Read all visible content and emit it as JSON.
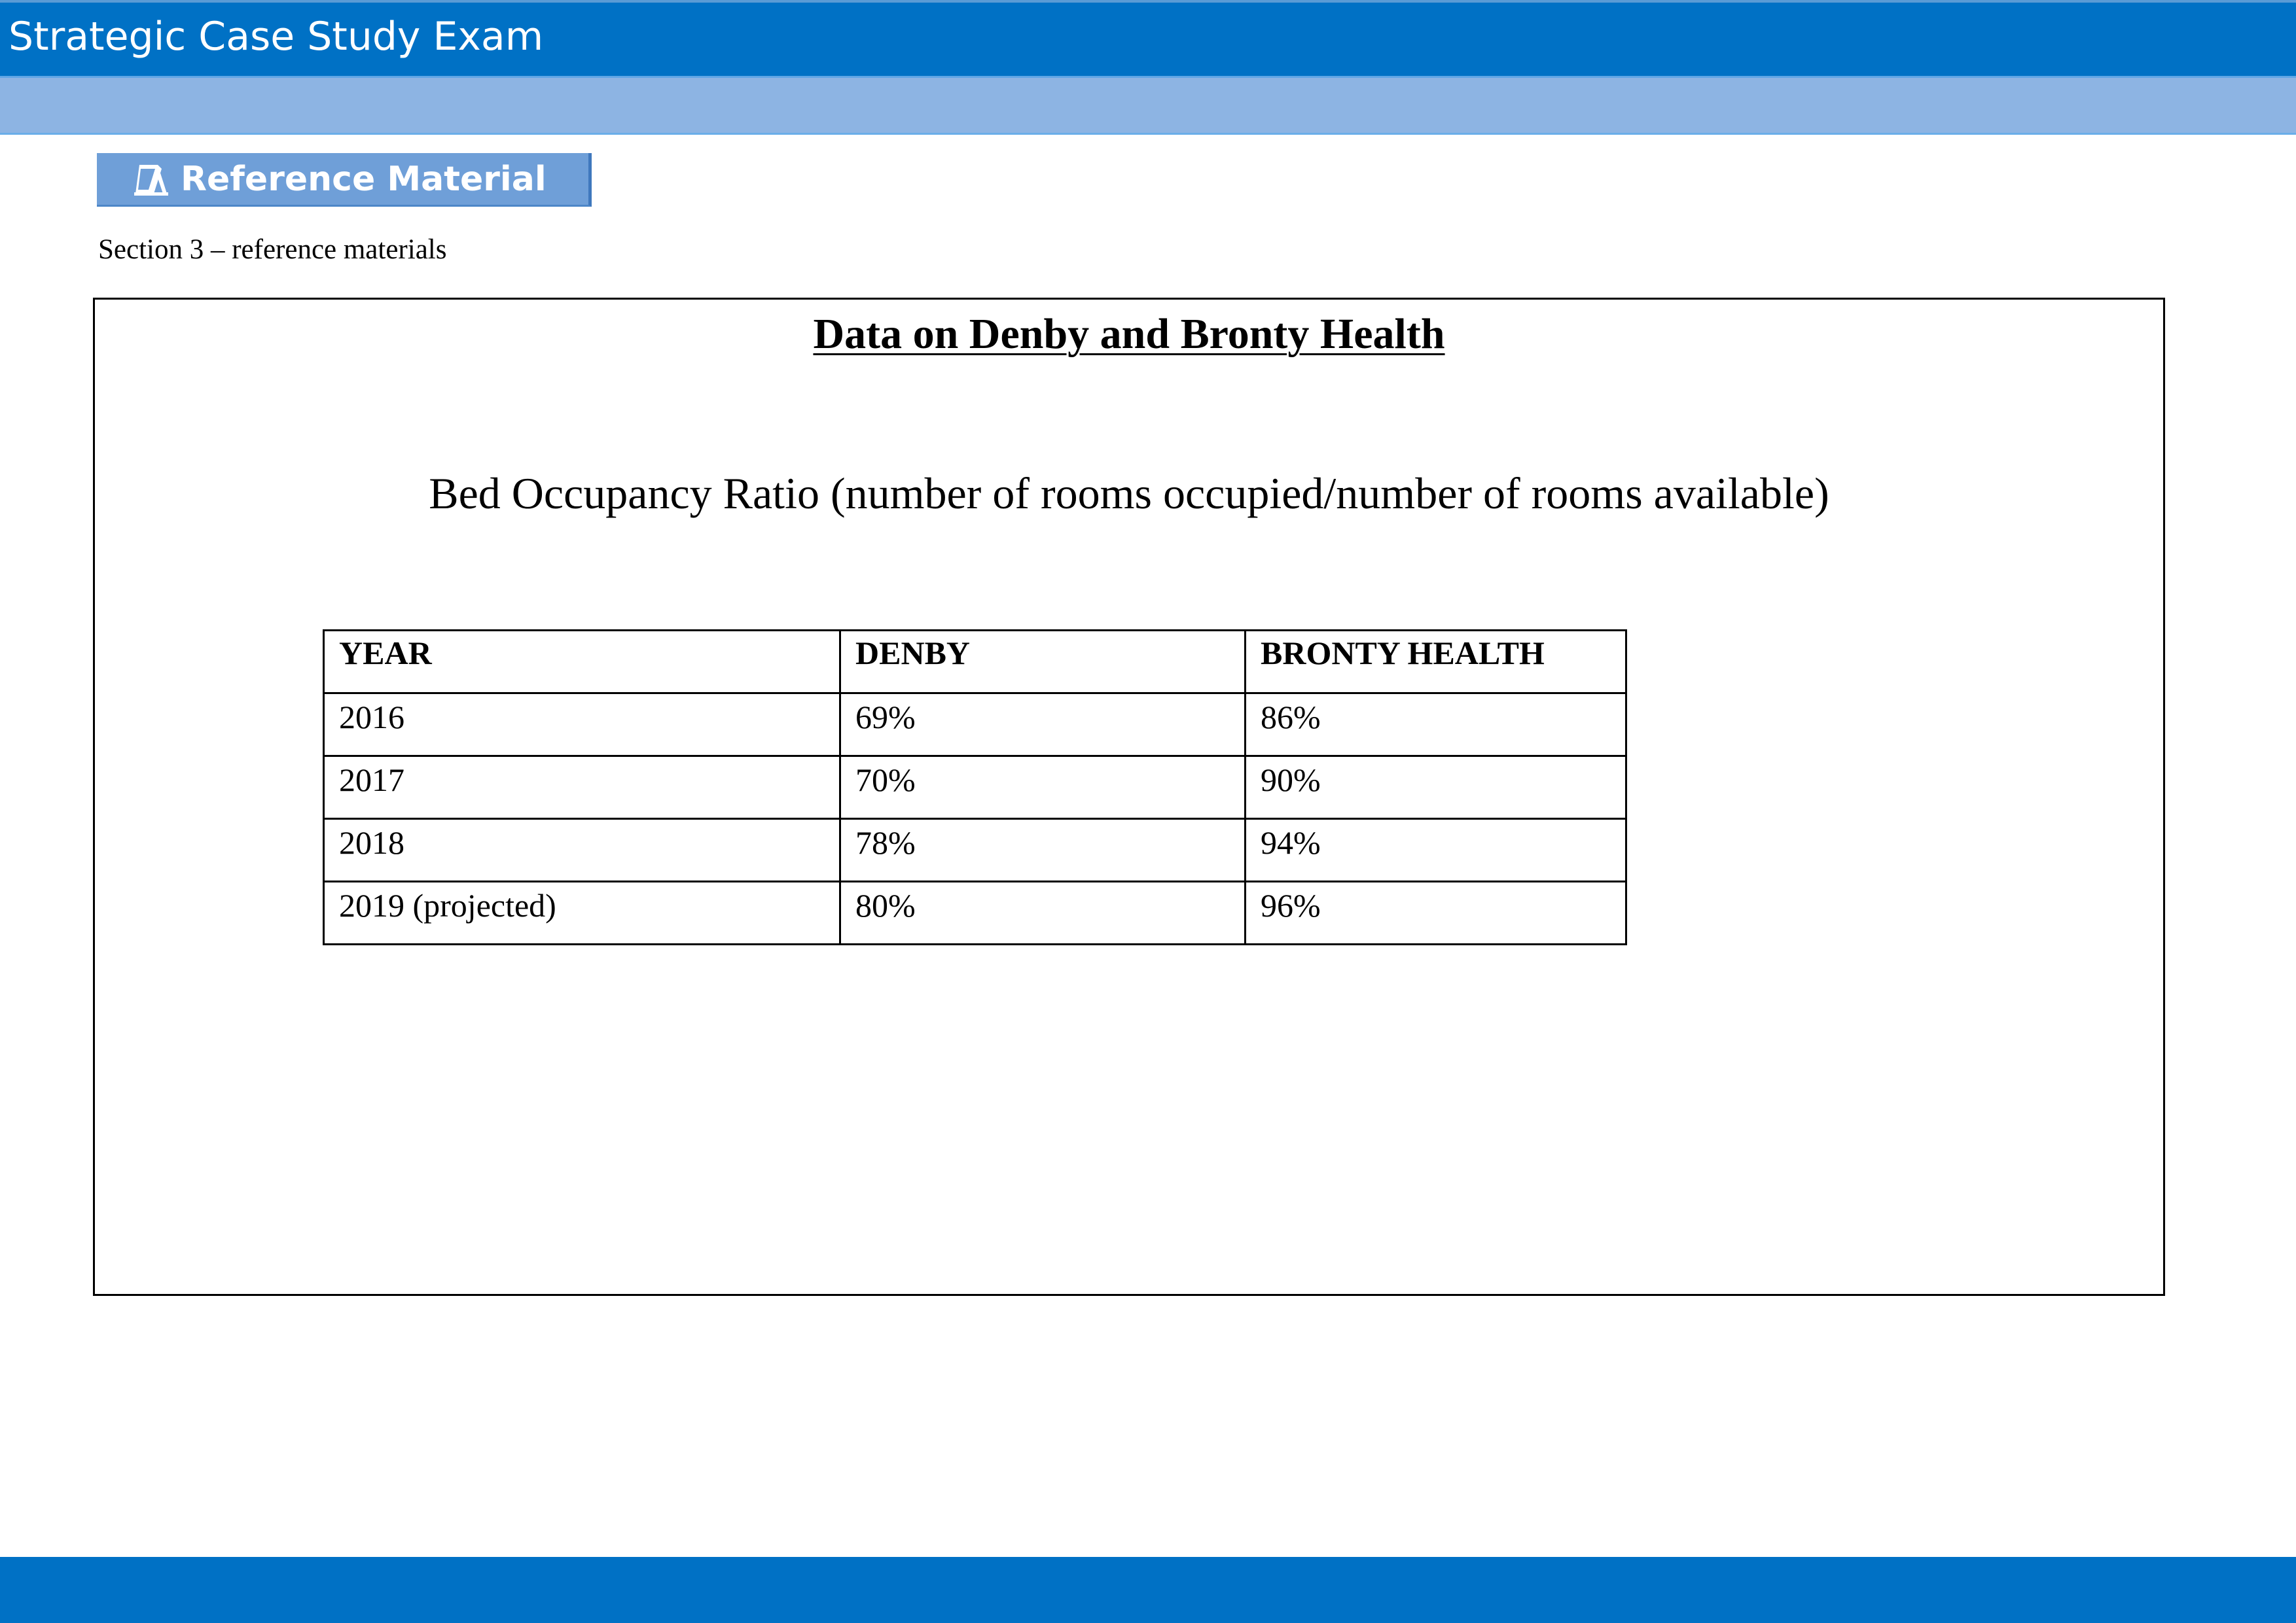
{
  "header": {
    "title": "Strategic Case Study Exam"
  },
  "toolbar": {
    "reference_button_label": "Reference Material",
    "reference_icon": "book-stand-icon"
  },
  "section": {
    "label": "Section 3 – reference materials"
  },
  "document": {
    "heading": "Data on Denby and Bronty Health",
    "table_caption": "Bed Occupancy Ratio (number of rooms occupied/number of rooms available)",
    "table": {
      "columns": [
        "YEAR",
        "DENBY",
        "BRONTY HEALTH"
      ],
      "rows": [
        [
          "2016",
          "69%",
          "86%"
        ],
        [
          "2017",
          "70%",
          "90%"
        ],
        [
          "2018",
          "78%",
          "94%"
        ],
        [
          "2019 (projected)",
          "80%",
          "96%"
        ]
      ]
    }
  },
  "colors": {
    "header_bar": "#0071c5",
    "sub_bar": "#8db4e3",
    "reference_button": "#6f9fd8",
    "footer_bar": "#0071c5"
  }
}
